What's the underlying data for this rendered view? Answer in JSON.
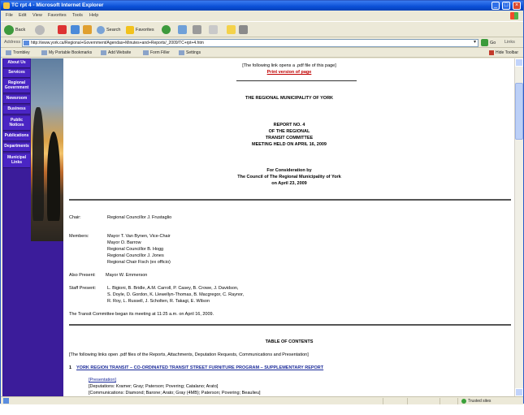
{
  "window": {
    "title": "TC rpt 4 - Microsoft Internet Explorer"
  },
  "menu": [
    "File",
    "Edit",
    "View",
    "Favorites",
    "Tools",
    "Help"
  ],
  "toolbar": {
    "back": "Back",
    "search": "Search",
    "favorites": "Favorites"
  },
  "address": {
    "label": "Address",
    "url": "http://www.york.ca/Regional+Government/Agendas+Minutes+and+Reports/_2009/TC+rpt+4.htm",
    "go": "Go",
    "links": "Links"
  },
  "linksbar": {
    "items": [
      "Trombley",
      "My Portable Bookmarks",
      "Add Website",
      "Form Filler",
      "Settings"
    ],
    "hide": "Hide Toolbar"
  },
  "nav": [
    "About Us",
    "Services",
    "Regional Government",
    "Newsroom",
    "Business",
    "Public Notices",
    "Publications",
    "Departments",
    "Municipal Links"
  ],
  "doc": {
    "pdf_note": "[The following link opens a .pdf file of this page]",
    "print_link": "Print version of page",
    "org_title": "THE REGIONAL MUNICIPALITY OF YORK",
    "report_lines": [
      "REPORT NO. 4",
      "OF THE REGIONAL",
      "TRANSIT COMMITTEE",
      "MEETING HELD ON APRIL 16, 2009"
    ],
    "consideration_lines": [
      "For Consideration by",
      "The Council of The Regional Municipality of York",
      "on April 23, 2009"
    ],
    "chair_label": "Chair:",
    "chair_value": "Regional Councillor J. Frustaglio",
    "members_label": "Members:",
    "members": [
      "Mayor T. Van Bynen, Vice-Chair",
      "Mayor O. Barrow",
      "Regional Councillor B. Hogg",
      "Regional Councillor J. Jones",
      "Regional Chair Fisch (ex officio)"
    ],
    "also_label": "Also Present:",
    "also_value": "Mayor W. Emmerson",
    "staff_label": "Staff Present:",
    "staff": [
      "L. Bigioni, B. Bridle, A.M. Carroll, P. Casey, B. Crowe, J. Davidson,",
      "S. Doyle, D. Gordon, K. Llewellyn-Thomas, B. Macgregor, C. Raynor,",
      "R. Roy, L. Russell, J. Scholten, R. Takagi, E. Wilson"
    ],
    "began": "The Transit Committee began its meeting at 11:25 a.m. on April 16, 2009.",
    "toc_title": "TABLE OF CONTENTS",
    "toc_note": "[The following links open .pdf files of the Reports, Attachments, Deputation Requests, Communications and Presentation]",
    "item1_num": "1",
    "item1_title": "YORK REGION TRANSIT – CO-ORDINATED TRANSIT STREET FURNITURE PROGRAM – SUPPLEMENTARY REPORT",
    "presentation": "[Presentation]",
    "deputations": "[Deputations: Kramer; Gray; Paterson; Povering; Catalano; Arato]",
    "communications": "[Communications: Diamond; Barone; Arato; Gray (4MB); Paterson; Povering; Beaulieu]"
  },
  "status": {
    "zone": "Trusted sites"
  }
}
